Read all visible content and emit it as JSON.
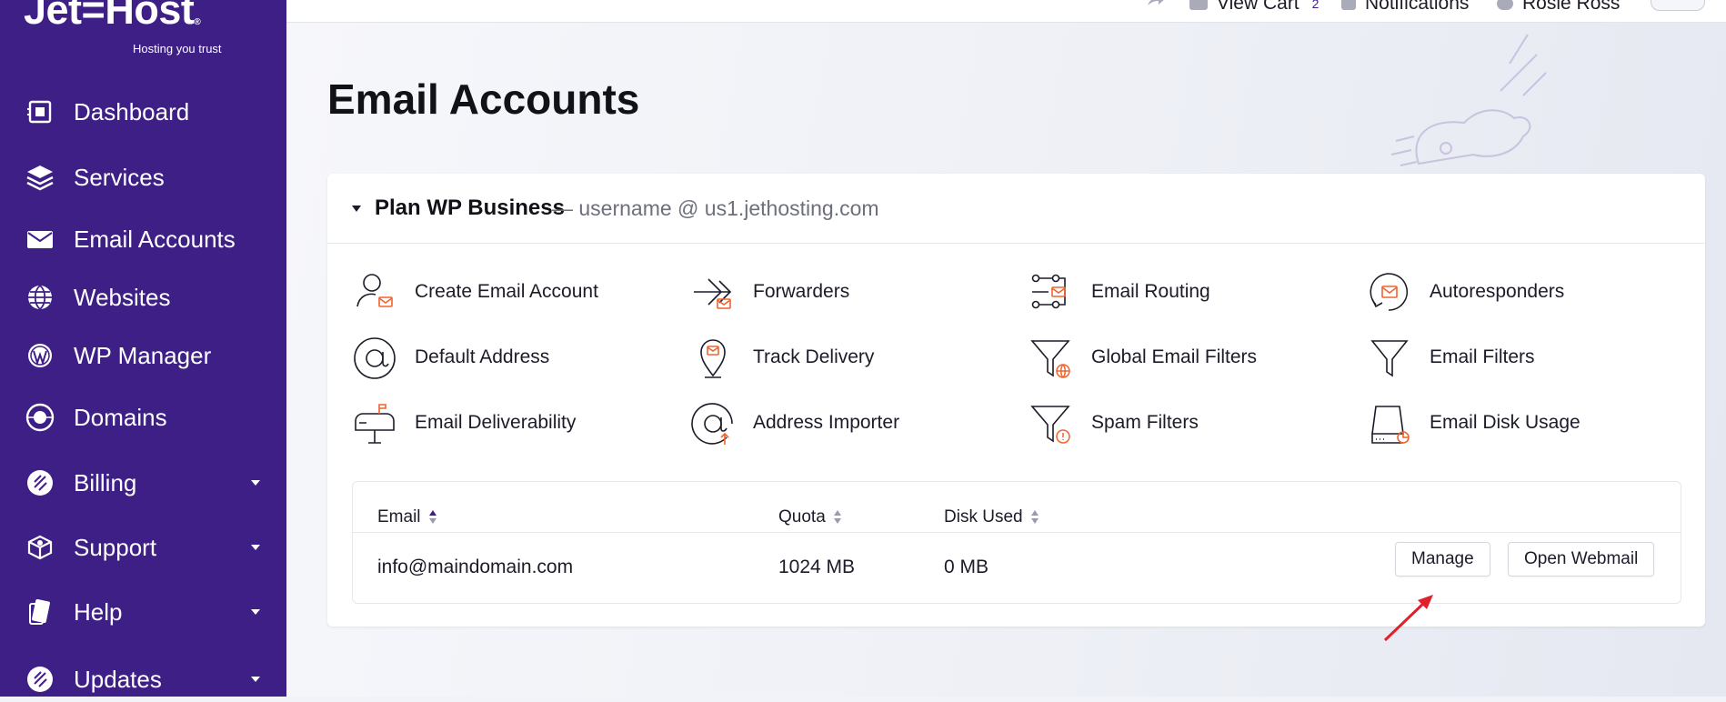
{
  "brand": {
    "name": "Jet",
    "name2": "Host",
    "trademark": "®",
    "tagline": "Hosting you trust"
  },
  "topbar": {
    "cart_label": "View Cart",
    "cart_count": "2",
    "notifications_label": "Notifications",
    "user_name": "Rosie Ross"
  },
  "sidebar": {
    "items": [
      {
        "label": "Dashboard",
        "icon": "dashboard-icon"
      },
      {
        "label": "Services",
        "icon": "services-icon"
      },
      {
        "label": "Email Accounts",
        "icon": "envelope-icon"
      },
      {
        "label": "Websites",
        "icon": "globe-icon"
      },
      {
        "label": "WP Manager",
        "icon": "wordpress-icon"
      },
      {
        "label": "Domains",
        "icon": "domain-icon"
      },
      {
        "label": "Billing",
        "icon": "billing-icon"
      },
      {
        "label": "Support",
        "icon": "support-icon"
      },
      {
        "label": "Help",
        "icon": "help-icon"
      },
      {
        "label": "Updates",
        "icon": "updates-icon"
      }
    ]
  },
  "page": {
    "title": "Email Accounts"
  },
  "plan": {
    "name": "Plan WP Business",
    "subtitle": "— username @ us1.jethosting.com"
  },
  "tools": [
    {
      "label": "Create Email Account"
    },
    {
      "label": "Forwarders"
    },
    {
      "label": "Email Routing"
    },
    {
      "label": "Autoresponders"
    },
    {
      "label": "Default Address"
    },
    {
      "label": "Track Delivery"
    },
    {
      "label": "Global Email Filters"
    },
    {
      "label": "Email Filters"
    },
    {
      "label": "Email Deliverability"
    },
    {
      "label": "Address Importer"
    },
    {
      "label": "Spam Filters"
    },
    {
      "label": "Email Disk Usage"
    }
  ],
  "table": {
    "headers": {
      "email": "Email",
      "quota": "Quota",
      "disk_used": "Disk Used"
    },
    "rows": [
      {
        "email": "info@maindomain.com",
        "quota": "1024 MB",
        "disk_used": "0 MB"
      }
    ],
    "manage_label": "Manage",
    "webmail_label": "Open Webmail"
  },
  "colors": {
    "sidebar_bg": "#3d1f86",
    "accent_orange": "#f0642d",
    "annotation_arrow": "#e0202a"
  }
}
